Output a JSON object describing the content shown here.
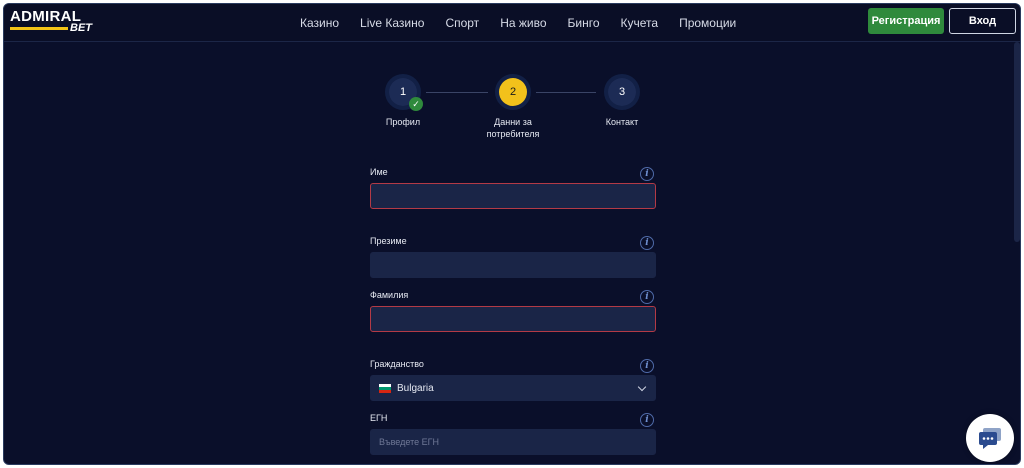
{
  "header": {
    "logo_top": "ADMIRAL",
    "logo_bottom": "BET",
    "nav": [
      "Казино",
      "Live Казино",
      "Спорт",
      "На живо",
      "Бинго",
      "Кучета",
      "Промоции"
    ],
    "register_label": "Регистрация",
    "login_label": "Вход"
  },
  "stepper": {
    "steps": [
      {
        "number": "1",
        "label": "Профил",
        "state": "completed"
      },
      {
        "number": "2",
        "label": "Данни за потребителя",
        "state": "active"
      },
      {
        "number": "3",
        "label": "Контакт",
        "state": "pending"
      }
    ]
  },
  "form": {
    "first_name_label": "Име",
    "first_name_value": "",
    "middle_name_label": "Презиме",
    "middle_name_value": "",
    "last_name_label": "Фамилия",
    "last_name_value": "",
    "citizenship_label": "Гражданство",
    "citizenship_value": "Bulgaria",
    "egn_label": "ЕГН",
    "egn_placeholder": "Въведете ЕГН",
    "info_glyph": "i"
  },
  "colors": {
    "background": "#0a0f2a",
    "accent_yellow": "#f2c11b",
    "success_green": "#2f8a3c",
    "error_red": "#b33a46",
    "input_bg": "#1a2547"
  },
  "icons": {
    "check": "check-icon",
    "info": "info-icon",
    "chevron": "chevron-down-icon",
    "chat": "chat-icon",
    "flag": "bulgaria-flag-icon"
  }
}
